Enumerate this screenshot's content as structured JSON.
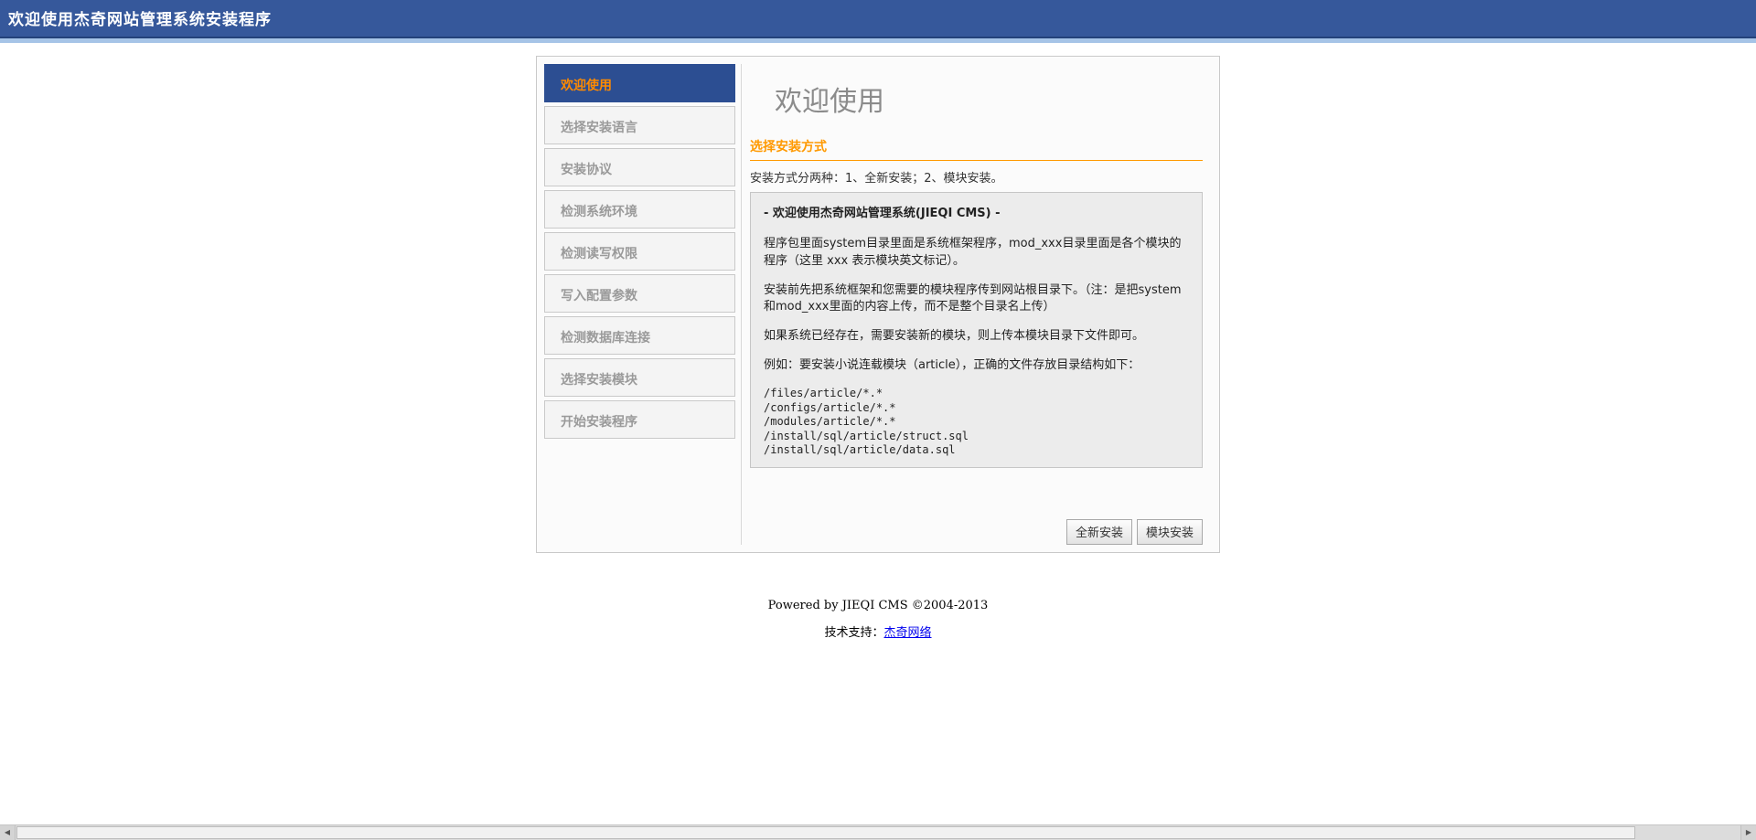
{
  "header": {
    "title": "欢迎使用杰奇网站管理系统安装程序"
  },
  "wizard": {
    "steps": [
      "欢迎使用",
      "选择安装语言",
      "安装协议",
      "检测系统环境",
      "检测读写权限",
      "写入配置参数",
      "检测数据库连接",
      "选择安装模块",
      "开始安装程序"
    ],
    "active_step": "欢迎使用"
  },
  "content": {
    "title": "欢迎使用",
    "section_title": "选择安装方式",
    "intro": "安装方式分两种：1、全新安装；2、模块安装。",
    "info_box": {
      "title": "- 欢迎使用杰奇网站管理系统(JIEQI CMS) -",
      "paragraphs": [
        "程序包里面system目录里面是系统框架程序，mod_xxx目录里面是各个模块的程序（这里 xxx 表示模块英文标记）。",
        "安装前先把系统框架和您需要的模块程序传到网站根目录下。（注：是把system和mod_xxx里面的内容上传，而不是整个目录名上传）",
        "如果系统已经存在，需要安装新的模块，则上传本模块目录下文件即可。",
        "例如：要安装小说连载模块（article），正确的文件存放目录结构如下："
      ],
      "file_list": [
        "/files/article/*.*",
        "/configs/article/*.*",
        "/modules/article/*.*",
        "/install/sql/article/struct.sql",
        "/install/sql/article/data.sql"
      ]
    },
    "buttons": {
      "new_install": "全新安装",
      "module_install": "模块安装"
    }
  },
  "footer": {
    "powered_by": "Powered by JIEQI CMS ©2004-2013",
    "support_label": "技术支持：",
    "support_link": "杰奇网络"
  },
  "colors": {
    "header_blue": "#36589B",
    "header_strip_blue": "#A6C4E7",
    "active_step_blue": "#2C4E92",
    "accent_orange": "#FF9900",
    "active_step_text_orange": "#FF8A00",
    "link_blue": "#0000EE",
    "info_box_gray": "#ececec"
  }
}
